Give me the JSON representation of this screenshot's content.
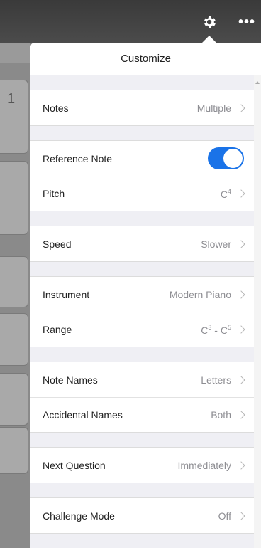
{
  "popover": {
    "title": "Customize"
  },
  "background": {
    "digit": "1"
  },
  "accent_color": "#1a73e8",
  "settings": {
    "notes": {
      "label": "Notes",
      "value": "Multiple"
    },
    "reference": {
      "label": "Reference Note",
      "enabled": true
    },
    "pitch": {
      "label": "Pitch",
      "note": "C",
      "octave": "4"
    },
    "speed": {
      "label": "Speed",
      "value": "Slower"
    },
    "instrument": {
      "label": "Instrument",
      "value": "Modern Piano"
    },
    "range": {
      "label": "Range",
      "low_note": "C",
      "low_octave": "3",
      "separator": " - ",
      "high_note": "C",
      "high_octave": "5"
    },
    "note_names": {
      "label": "Note Names",
      "value": "Letters"
    },
    "accidental_names": {
      "label": "Accidental Names",
      "value": "Both"
    },
    "next_question": {
      "label": "Next Question",
      "value": "Immediately"
    },
    "challenge_mode": {
      "label": "Challenge Mode",
      "value": "Off"
    }
  },
  "icons": {
    "settings": "gear-icon",
    "more": "ellipsis-icon"
  }
}
